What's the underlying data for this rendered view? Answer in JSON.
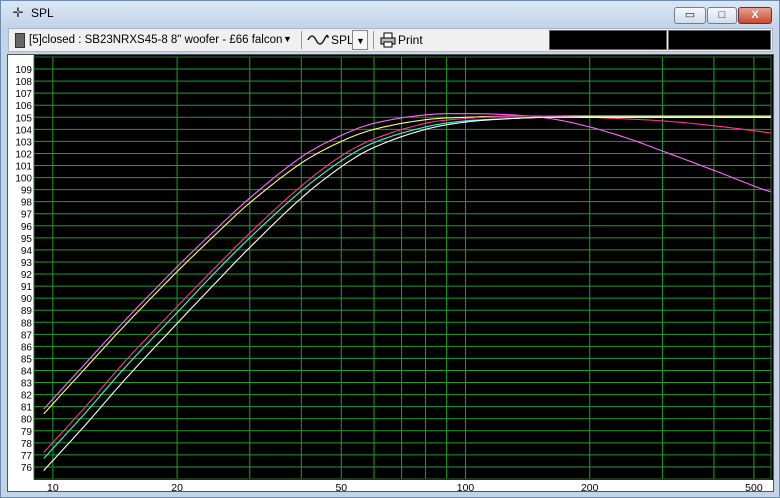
{
  "window": {
    "title": "SPL",
    "min_symbol": "▭",
    "max_symbol": "□",
    "close_symbol": "X"
  },
  "toolbar": {
    "project_label": "[5]closed : SB23NRXS45-8 8\" woofer - £66 falcon",
    "mode_label": "SPL",
    "print_label": "Print"
  },
  "chart_data": {
    "type": "line",
    "x_scale": "log",
    "xlim": [
      9,
      550
    ],
    "ylim": [
      75,
      110
    ],
    "y_ticks": [
      76,
      77,
      78,
      79,
      80,
      81,
      82,
      83,
      84,
      85,
      86,
      87,
      88,
      89,
      90,
      91,
      92,
      93,
      94,
      95,
      96,
      97,
      98,
      99,
      100,
      101,
      102,
      103,
      104,
      105,
      106,
      107,
      108,
      109
    ],
    "x_tick_labels": [
      {
        "v": 10,
        "label": "10"
      },
      {
        "v": 20,
        "label": "20"
      },
      {
        "v": 50,
        "label": "50"
      },
      {
        "v": 100,
        "label": "100"
      },
      {
        "v": 200,
        "label": "200"
      },
      {
        "v": 500,
        "label": "500"
      }
    ],
    "x_gridlines": [
      10,
      20,
      30,
      40,
      50,
      60,
      70,
      80,
      90,
      100,
      200,
      300,
      400,
      500
    ],
    "grid": true,
    "background": "#000000",
    "grid_color": "#1f9e2a",
    "axis_text_color": "#000000",
    "series": [
      {
        "color": "#ff66ff",
        "x": [
          9.5,
          12,
          15,
          20,
          25,
          30,
          40,
          50,
          60,
          80,
          100,
          130,
          160,
          200,
          250,
          300,
          400,
          500,
          550
        ],
        "y": [
          80.8,
          84.6,
          88.2,
          92.6,
          95.8,
          98.3,
          101.7,
          103.5,
          104.5,
          105.2,
          105.3,
          105.2,
          104.9,
          104.2,
          103.2,
          102.2,
          100.6,
          99.3,
          98.8
        ]
      },
      {
        "color": "#ffff66",
        "x": [
          9.5,
          12,
          15,
          20,
          25,
          30,
          40,
          50,
          60,
          80,
          100,
          130,
          160,
          200,
          300,
          400,
          550
        ],
        "y": [
          80.4,
          84.2,
          87.8,
          92.2,
          95.4,
          97.9,
          101.2,
          103.0,
          104.0,
          104.8,
          105.0,
          105.1,
          105.1,
          105.1,
          105.1,
          105.1,
          105.1
        ]
      },
      {
        "color": "#ff3399",
        "x": [
          9.5,
          12,
          15,
          20,
          25,
          30,
          40,
          50,
          60,
          80,
          100,
          130,
          160,
          200,
          300,
          400,
          550
        ],
        "y": [
          77.2,
          81.0,
          84.8,
          89.3,
          92.7,
          95.4,
          99.3,
          101.8,
          103.2,
          104.5,
          104.9,
          105.1,
          105.1,
          105.0,
          104.7,
          104.3,
          103.7
        ]
      },
      {
        "color": "#33ffcc",
        "x": [
          9.5,
          12,
          15,
          20,
          25,
          30,
          40,
          50,
          60,
          80,
          100,
          130,
          160,
          200,
          300,
          400,
          550
        ],
        "y": [
          76.7,
          80.5,
          84.3,
          88.8,
          92.3,
          95.0,
          98.9,
          101.4,
          102.9,
          104.2,
          104.7,
          104.9,
          105.0,
          105.0,
          105.0,
          105.0,
          105.0
        ]
      },
      {
        "color": "#ffffff",
        "x": [
          9.5,
          12,
          15,
          20,
          25,
          30,
          40,
          50,
          60,
          80,
          100,
          130,
          160,
          200,
          300,
          400,
          550
        ],
        "y": [
          75.7,
          79.5,
          83.3,
          87.9,
          91.4,
          94.2,
          98.3,
          100.9,
          102.5,
          104.0,
          104.6,
          104.9,
          105.0,
          105.0,
          105.0,
          105.0,
          105.0
        ]
      }
    ]
  }
}
